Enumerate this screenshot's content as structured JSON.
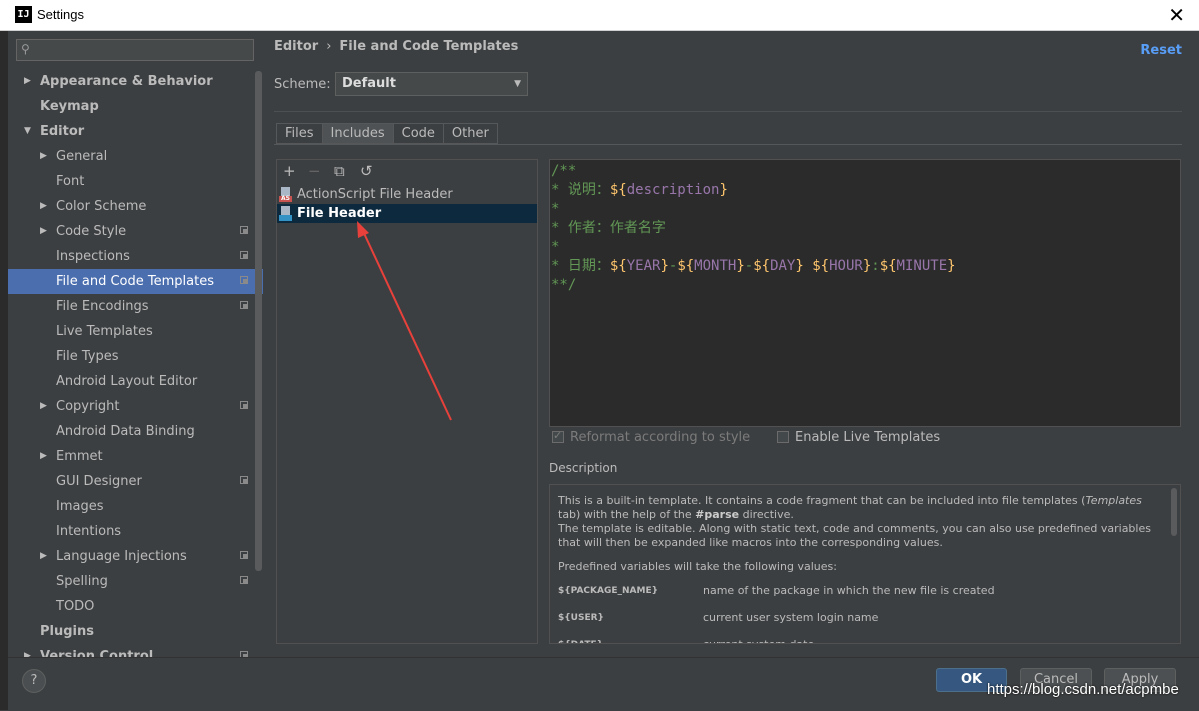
{
  "window": {
    "title": "Settings",
    "logo": "IJ"
  },
  "search": {
    "placeholder": ""
  },
  "sidebar": {
    "items": [
      {
        "label": "Appearance & Behavior",
        "level": 0,
        "arrow": "right",
        "bold": true
      },
      {
        "label": "Keymap",
        "level": 0,
        "bold": true
      },
      {
        "label": "Editor",
        "level": 0,
        "arrow": "down",
        "bold": true
      },
      {
        "label": "General",
        "level": 1,
        "arrow": "right"
      },
      {
        "label": "Font",
        "level": 1
      },
      {
        "label": "Color Scheme",
        "level": 1,
        "arrow": "right"
      },
      {
        "label": "Code Style",
        "level": 1,
        "arrow": "right",
        "project": true
      },
      {
        "label": "Inspections",
        "level": 1,
        "project": true
      },
      {
        "label": "File and Code Templates",
        "level": 1,
        "project": true,
        "selected": true
      },
      {
        "label": "File Encodings",
        "level": 1,
        "project": true
      },
      {
        "label": "Live Templates",
        "level": 1
      },
      {
        "label": "File Types",
        "level": 1
      },
      {
        "label": "Android Layout Editor",
        "level": 1
      },
      {
        "label": "Copyright",
        "level": 1,
        "arrow": "right",
        "project": true
      },
      {
        "label": "Android Data Binding",
        "level": 1
      },
      {
        "label": "Emmet",
        "level": 1,
        "arrow": "right"
      },
      {
        "label": "GUI Designer",
        "level": 1,
        "project": true
      },
      {
        "label": "Images",
        "level": 1
      },
      {
        "label": "Intentions",
        "level": 1
      },
      {
        "label": "Language Injections",
        "level": 1,
        "arrow": "right",
        "project": true
      },
      {
        "label": "Spelling",
        "level": 1,
        "project": true
      },
      {
        "label": "TODO",
        "level": 1
      },
      {
        "label": "Plugins",
        "level": 0,
        "bold": true
      },
      {
        "label": "Version Control",
        "level": 0,
        "arrow": "right",
        "bold": true,
        "project": true
      }
    ]
  },
  "header": {
    "breadcrumb_parent": "Editor",
    "breadcrumb_sep": "›",
    "breadcrumb_current": "File and Code Templates",
    "reset": "Reset"
  },
  "scheme": {
    "label": "Scheme:",
    "value": "Default"
  },
  "tabs": [
    {
      "label": "Files"
    },
    {
      "label": "Includes",
      "active": true
    },
    {
      "label": "Code"
    },
    {
      "label": "Other"
    }
  ],
  "toolbar": {
    "add": "+",
    "remove": "−",
    "copy": "⧉",
    "revert": "↺"
  },
  "templates": [
    {
      "label": "ActionScript File Header",
      "badge": "AS",
      "badge_color": "#c75450"
    },
    {
      "label": "File Header",
      "badge": "",
      "badge_color": "#3592c4",
      "selected": true
    }
  ],
  "code": {
    "lines": [
      [
        {
          "t": "/**",
          "c": "comment"
        }
      ],
      [
        {
          "t": "* 说明：",
          "c": "comment"
        },
        {
          "t": "${",
          "c": "brace"
        },
        {
          "t": "description",
          "c": "var"
        },
        {
          "t": "}",
          "c": "brace"
        }
      ],
      [
        {
          "t": "*",
          "c": "comment"
        }
      ],
      [
        {
          "t": "* 作者：作者名字",
          "c": "comment"
        }
      ],
      [
        {
          "t": "*",
          "c": "comment"
        }
      ],
      [
        {
          "t": "* 日期：",
          "c": "comment"
        },
        {
          "t": "${",
          "c": "brace"
        },
        {
          "t": "YEAR",
          "c": "var"
        },
        {
          "t": "}",
          "c": "brace"
        },
        {
          "t": "-",
          "c": "comment"
        },
        {
          "t": "${",
          "c": "brace"
        },
        {
          "t": "MONTH",
          "c": "var"
        },
        {
          "t": "}",
          "c": "brace"
        },
        {
          "t": "-",
          "c": "comment"
        },
        {
          "t": "${",
          "c": "brace"
        },
        {
          "t": "DAY",
          "c": "var"
        },
        {
          "t": "}",
          "c": "brace"
        },
        {
          "t": " ",
          "c": "comment"
        },
        {
          "t": "${",
          "c": "brace"
        },
        {
          "t": "HOUR",
          "c": "var"
        },
        {
          "t": "}",
          "c": "brace"
        },
        {
          "t": ":",
          "c": "comment"
        },
        {
          "t": "${",
          "c": "brace"
        },
        {
          "t": "MINUTE",
          "c": "var"
        },
        {
          "t": "}",
          "c": "brace"
        }
      ],
      [
        {
          "t": "**/",
          "c": "comment"
        }
      ]
    ]
  },
  "options": {
    "reformat": "Reformat according to style",
    "reformat_checked": true,
    "live_templates": "Enable Live Templates",
    "live_templates_checked": false
  },
  "description": {
    "label": "Description",
    "p1_a": "This is a built-in template. It contains a code fragment that can be included into file templates (",
    "p1_italic": "Templates",
    "p1_b": " tab) with the help of the ",
    "p1_bold": "#parse",
    "p1_c": " directive.",
    "p1_d": "The template is editable. Along with static text, code and comments, you can also use predefined variables that will then be expanded like macros into the corresponding values.",
    "p2": "Predefined variables will take the following values:",
    "vars": [
      {
        "name": "${PACKAGE_NAME}",
        "desc": "name of the package in which the new file is created"
      },
      {
        "name": "${USER}",
        "desc": "current user system login name"
      },
      {
        "name": "${DATE}",
        "desc": "current system date"
      }
    ]
  },
  "footer": {
    "help": "?",
    "ok": "OK",
    "cancel": "Cancel",
    "apply": "Apply"
  },
  "watermark": "https://blog.csdn.net/acpmbe",
  "colors": {
    "selection": "#4b6eaf",
    "accent": "#589df6",
    "annotation_arrow": "#e8413b"
  }
}
